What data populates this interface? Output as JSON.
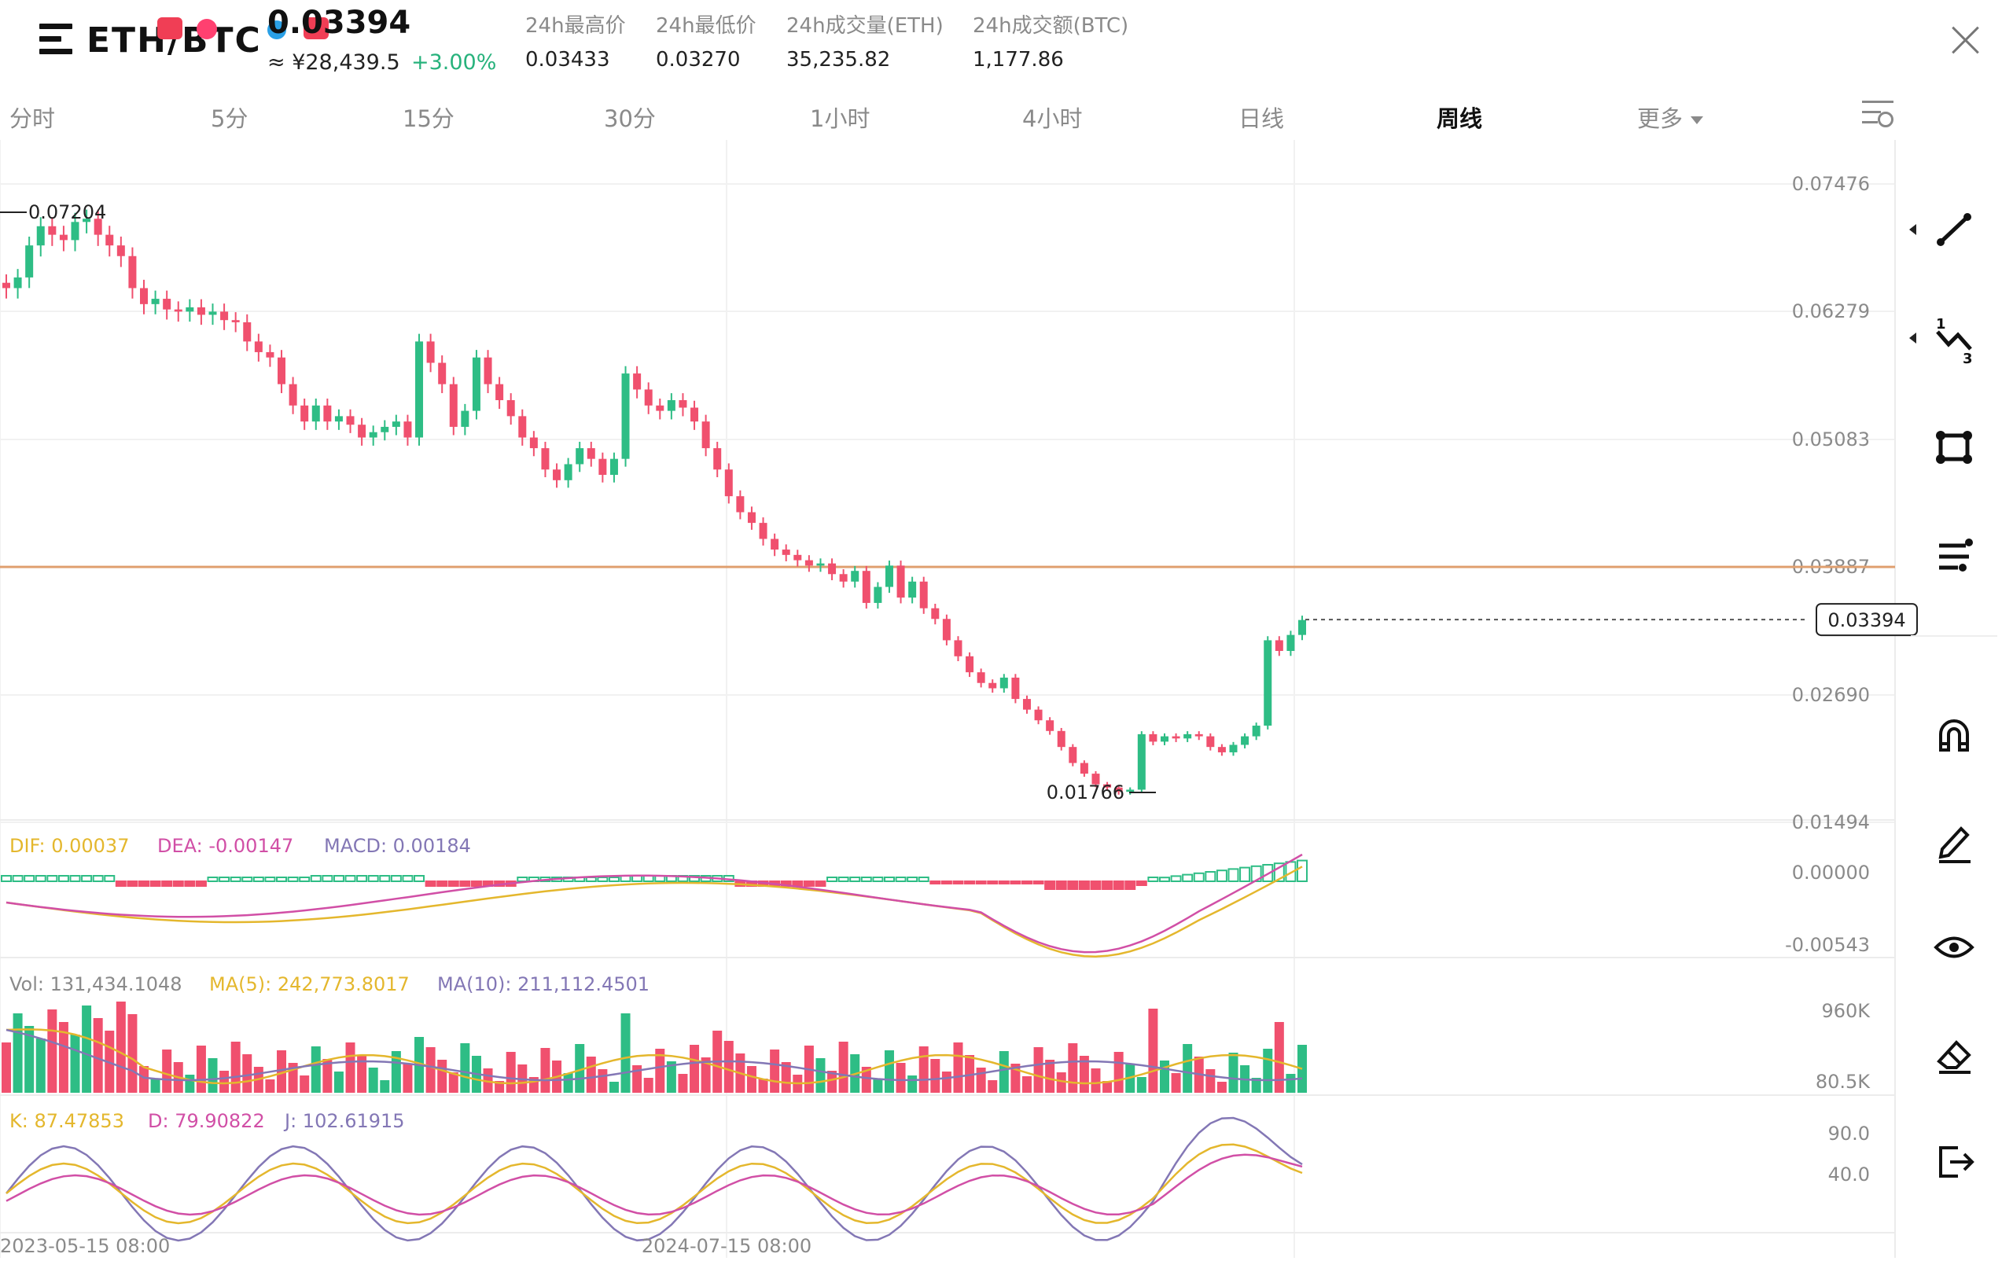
{
  "header": {
    "pair": "ETH/BTC",
    "price": "0.03394",
    "cny_price": "≈ ¥28,439.5",
    "change": "+3.00%",
    "stats": [
      {
        "label": "24h最高价",
        "value": "0.03433"
      },
      {
        "label": "24h最低价",
        "value": "0.03270"
      },
      {
        "label": "24h成交量(ETH)",
        "value": "35,235.82"
      },
      {
        "label": "24h成交额(BTC)",
        "value": "1,177.86"
      }
    ]
  },
  "tabs": [
    "分时",
    "5分",
    "15分",
    "30分",
    "1小时",
    "4小时",
    "日线",
    "周线",
    "更多"
  ],
  "active_tab": "周线",
  "price_axis": [
    "0.07476",
    "0.06279",
    "0.05083",
    "0.03887",
    "0.02690",
    "0.01494"
  ],
  "current_price_tag": "0.03394",
  "marks": {
    "high": "0.07204",
    "low": "0.01766"
  },
  "macd": {
    "dif": "DIF: 0.00037",
    "dea": "DEA: -0.00147",
    "macd": "MACD: 0.00184",
    "axis": [
      "0.00000",
      "-0.00543"
    ]
  },
  "volume": {
    "vol": "Vol: 131,434.1048",
    "ma5": "MA(5): 242,773.8017",
    "ma10": "MA(10): 211,112.4501",
    "axis": [
      "960K",
      "80.5K"
    ]
  },
  "kdj": {
    "k": "K: 87.47853",
    "d": "D: 79.90822",
    "j": "J: 102.61915",
    "axis": [
      "90.0",
      "40.0"
    ]
  },
  "time_axis": [
    "2023-05-15 08:00",
    "2024-07-15 08:00"
  ],
  "colors": {
    "up": "#2ebd85",
    "down": "#f0506e",
    "dif": "#e4b72d",
    "dea": "#d14fa6",
    "j": "#8377b5",
    "hline": "#e0a070"
  },
  "icons": [
    "menu-icon",
    "line-tool-icon",
    "fib-tool-icon",
    "shape-tool-icon",
    "text-tool-icon",
    "magnet-icon",
    "pen-icon",
    "eye-icon",
    "eraser-icon",
    "exit-icon",
    "close-icon",
    "settings-icon"
  ]
}
